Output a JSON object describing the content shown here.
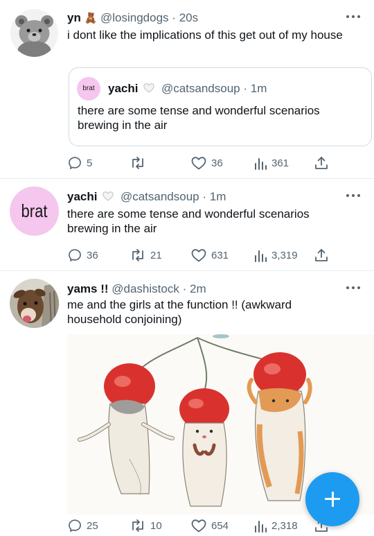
{
  "tweets": [
    {
      "name": "yn",
      "name_emoji": "🧸",
      "handle": "@losingdogs",
      "dot": "·",
      "time": "20s",
      "text": "i dont like the implications of this get out of my house",
      "quote": {
        "avatar_text": "brat",
        "name": "yachi",
        "handle": "@catsandsoup",
        "dot": "·",
        "time": "1m",
        "text": "there are some tense and wonderful scenarios brewing in the air"
      },
      "replies": "5",
      "retweets": "",
      "likes": "36",
      "views": "361"
    },
    {
      "avatar_text": "brat",
      "name": "yachi",
      "handle": "@catsandsoup",
      "dot": "·",
      "time": "1m",
      "text": "there are some tense and wonderful scenarios brewing in the air",
      "replies": "36",
      "retweets": "21",
      "likes": "631",
      "views": "3,319"
    },
    {
      "name": "yams !!",
      "handle": "@dashistock",
      "dot": "·",
      "time": "2m",
      "text": "me and the girls at the function !! (awkward household conjoining)",
      "replies": "25",
      "retweets": "10",
      "likes": "654",
      "views": "2,318"
    }
  ],
  "colors": {
    "accent": "#1d9bf0",
    "muted": "#536471",
    "brat_pink": "#f5c6ee"
  },
  "icons": [
    "reply-icon",
    "retweet-icon",
    "like-icon",
    "views-icon",
    "share-icon",
    "more-icon",
    "compose-icon"
  ]
}
